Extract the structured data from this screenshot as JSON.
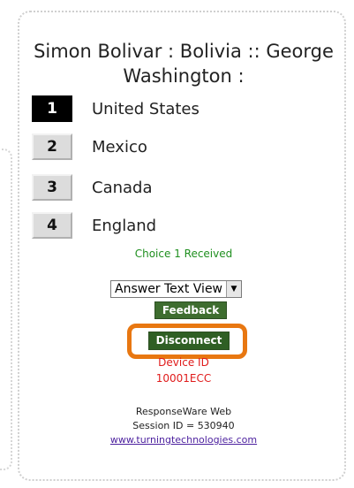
{
  "question": {
    "line1": "Simon Bolivar : Bolivia :: George",
    "line2": "Washington :"
  },
  "choices": [
    {
      "number": "1",
      "label": "United States",
      "selected": true
    },
    {
      "number": "2",
      "label": "Mexico",
      "selected": false
    },
    {
      "number": "3",
      "label": "Canada",
      "selected": false
    },
    {
      "number": "4",
      "label": "England",
      "selected": false
    }
  ],
  "status": {
    "received": "Choice 1 Received"
  },
  "view_select": {
    "selected": "Answer Text View"
  },
  "buttons": {
    "feedback": "Feedback",
    "disconnect": "Disconnect"
  },
  "device": {
    "label": "Device ID",
    "id": "10001ECC"
  },
  "footer": {
    "brand": "ResponseWare Web",
    "session": "Session ID = 530940",
    "link": "www.turningtechnologies.com"
  },
  "colors": {
    "accent_green": "#3e6d2f",
    "received_green": "#1f8f1f",
    "device_red": "#e01b1b",
    "highlight_orange": "#e87711"
  }
}
